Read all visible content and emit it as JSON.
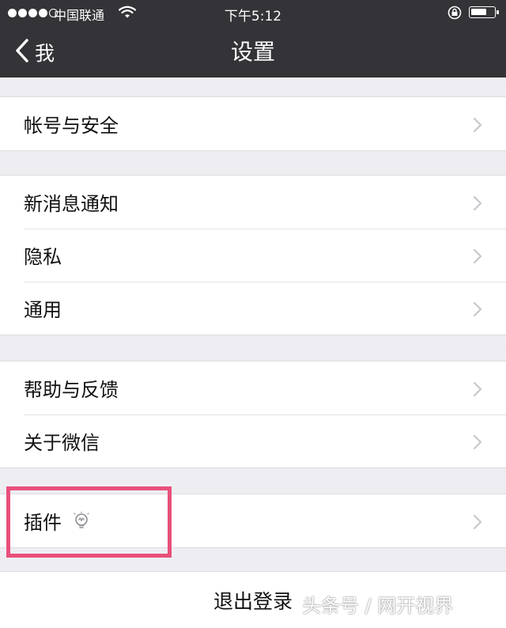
{
  "status_bar": {
    "carrier": "中国联通",
    "time": "下午5:12",
    "icons": [
      "signal-dots",
      "wifi-icon",
      "rotation-lock-icon",
      "battery-icon"
    ]
  },
  "nav": {
    "back_label": "我",
    "title": "设置"
  },
  "groups": [
    {
      "items": [
        {
          "label": "帐号与安全"
        }
      ]
    },
    {
      "items": [
        {
          "label": "新消息通知"
        },
        {
          "label": "隐私"
        },
        {
          "label": "通用"
        }
      ]
    },
    {
      "items": [
        {
          "label": "帮助与反馈"
        },
        {
          "label": "关于微信"
        }
      ]
    },
    {
      "items": [
        {
          "label": "插件",
          "icon": "lightbulb-icon"
        }
      ]
    }
  ],
  "logout_label": "退出登录",
  "watermark": "头条号 / 网开视界",
  "colors": {
    "nav_bg": "#333338",
    "page_bg": "#eeeef2",
    "highlight": "#e9507a"
  }
}
